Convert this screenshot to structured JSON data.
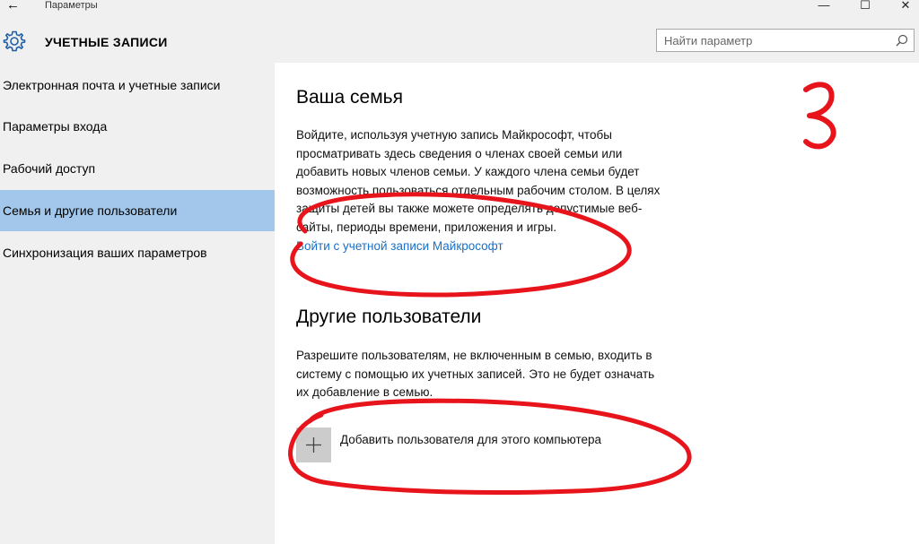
{
  "window": {
    "app_title": "Параметры",
    "back_glyph": "←",
    "minimize_glyph": "—",
    "maximize_glyph": "☐",
    "close_glyph": "✕"
  },
  "header": {
    "icon": "gear-icon",
    "section_title": "УЧЕТНЫЕ ЗАПИСИ"
  },
  "search": {
    "placeholder": "Найти параметр",
    "value": "",
    "icon": "search-icon"
  },
  "sidebar": {
    "items": [
      {
        "label": "Электронная почта и учетные записи",
        "selected": false
      },
      {
        "label": "Параметры входа",
        "selected": false
      },
      {
        "label": "Рабочий доступ",
        "selected": false
      },
      {
        "label": "Семья и другие пользователи",
        "selected": true
      },
      {
        "label": "Синхронизация ваших параметров",
        "selected": false
      }
    ]
  },
  "main": {
    "family": {
      "heading": "Ваша семья",
      "lines": [
        "Войдите, используя учетную запись Майкрософт, чтобы",
        "просматривать здесь сведения о членах своей семьи или",
        "добавить новых членов семьи. У каждого члена семьи будет",
        "возможность пользоваться отдельным рабочим столом. В целях",
        "защиты детей вы также можете определять допустимые веб-",
        "сайты, периоды времени, приложения и игры."
      ],
      "signin_link": "Войти с учетной записи Майкрософт"
    },
    "others": {
      "heading": "Другие пользователи",
      "lines": [
        "Разрешите пользователям, не включенным в семью, входить в",
        "систему с помощью их учетных записей. Это не будет означать",
        "их добавление в семью."
      ],
      "add_button_label": "Добавить пользователя для этого компьютера",
      "add_icon": "plus-icon"
    }
  },
  "annotation": {
    "handwritten_number": "3",
    "color": "#e8141c"
  },
  "colors": {
    "chrome_bg": "#f0f0f0",
    "selected_bg": "#a3c7ea",
    "link": "#1a6fc7",
    "add_tile": "#cccccc"
  }
}
